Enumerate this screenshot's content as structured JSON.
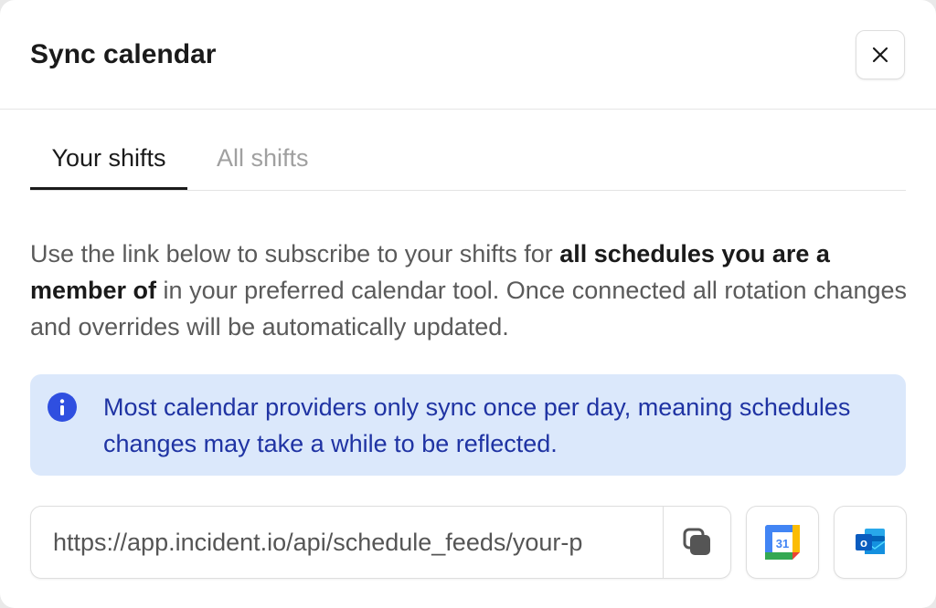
{
  "dialog": {
    "title": "Sync calendar",
    "close_icon": "close-icon"
  },
  "tabs": [
    {
      "label": "Your shifts",
      "active": true
    },
    {
      "label": "All shifts",
      "active": false
    }
  ],
  "description": {
    "part1": "Use the link below to subscribe to your shifts for ",
    "bold": "all schedules you are a member of",
    "part2": " in your preferred calendar tool. Once connected all rotation changes and overrides will be automatically updated."
  },
  "callout": {
    "icon": "info-icon",
    "message": "Most calendar providers only sync once per day, meaning schedules changes may take a while to be reflected."
  },
  "feed": {
    "url": "https://app.incident.io/api/schedule_feeds/your-p",
    "copy_icon": "copy-icon",
    "google_calendar_icon": "google-calendar-icon",
    "google_calendar_day": "31",
    "outlook_icon": "outlook-icon",
    "outlook_letter": "o"
  },
  "colors": {
    "callout_bg": "#dbe8fb",
    "callout_text": "#1f33a3",
    "info_icon": "#2f4fe0"
  }
}
